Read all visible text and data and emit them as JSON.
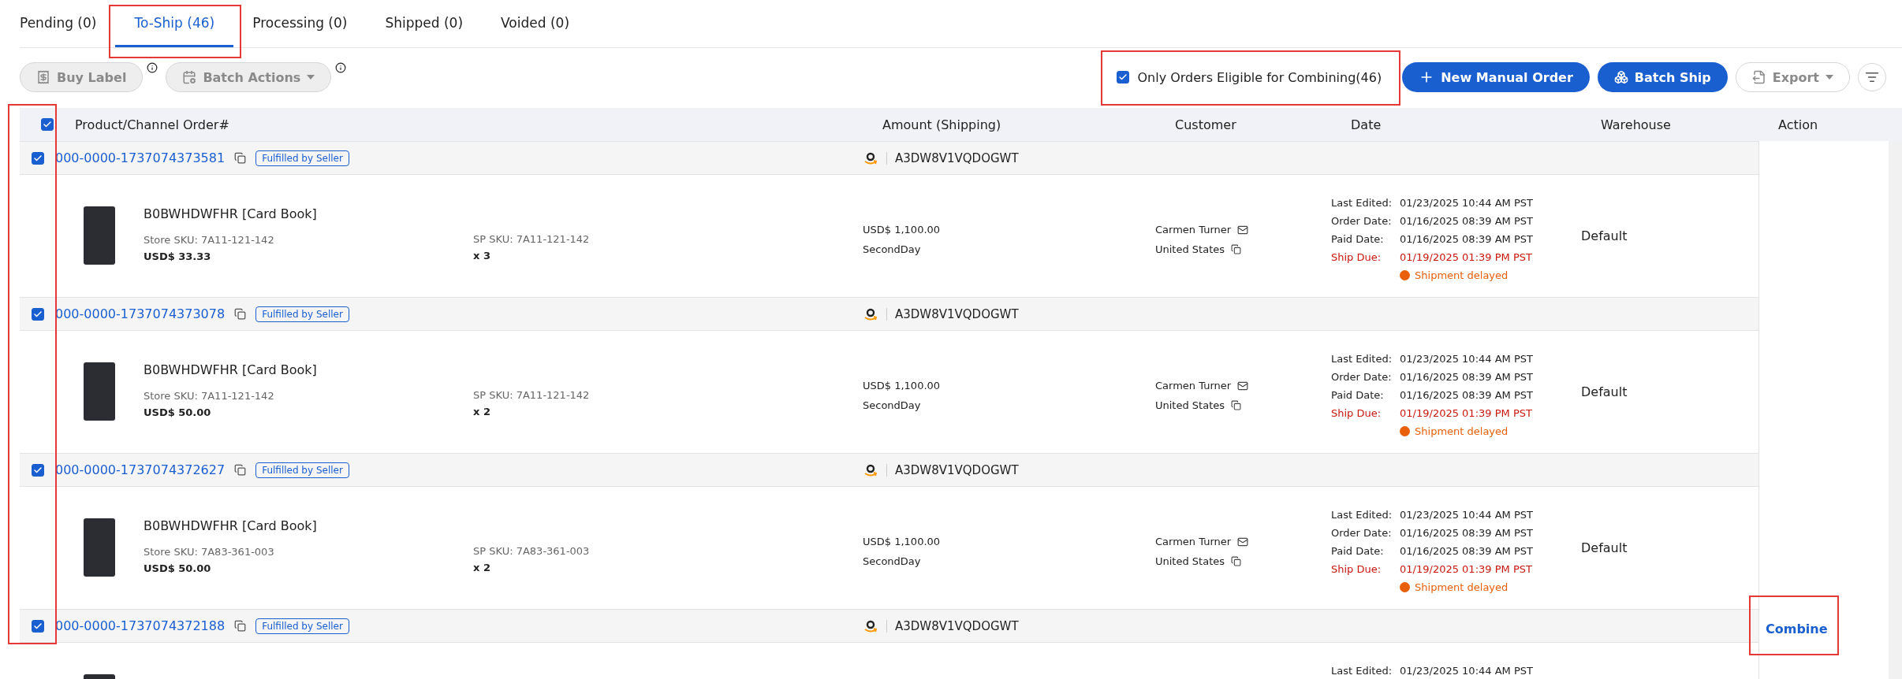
{
  "tabs": [
    {
      "label": "Pending (0)",
      "selected": false
    },
    {
      "label": "To-Ship (46)",
      "selected": true
    },
    {
      "label": "Processing (0)",
      "selected": false
    },
    {
      "label": "Shipped (0)",
      "selected": false
    },
    {
      "label": "Voided (0)",
      "selected": false
    }
  ],
  "toolbar": {
    "buy_label": {
      "label": "Buy Label",
      "disabled": true
    },
    "batch_actions": {
      "label": "Batch Actions",
      "disabled": true
    },
    "eligible_filter": {
      "label": "Only Orders Eligible for Combining(46)",
      "checked": true
    },
    "new_order": {
      "label": "New Manual Order",
      "disabled": false
    },
    "batch_ship": {
      "label": "Batch Ship",
      "disabled": false
    },
    "export": {
      "label": "Export",
      "disabled": true
    }
  },
  "table": {
    "select_all_checked": true,
    "columns": [
      "Product/Channel Order#",
      "Amount (Shipping)",
      "Customer",
      "Date",
      "Warehouse",
      "Action"
    ],
    "orders": [
      {
        "checked": true,
        "order_no": "000-0000-1737074373581",
        "fulfillment": "Fulfilled by Seller",
        "store_id": "A3DW8V1VQDOGWT",
        "product": {
          "title": "B0BWHDWFHR [Card Book]",
          "store_sku": "Store SKU: 7A11-121-142",
          "price": "USD$ 33.33",
          "sp_sku": "SP SKU: 7A11-121-142",
          "qty": "x 3"
        },
        "amount": "USD$ 1,100.00",
        "shipping": "SecondDay",
        "customer": "Carmen Turner",
        "country": "United States",
        "dates": [
          {
            "label": "Last Edited:",
            "value": "01/23/2025 10:44 AM PST",
            "kind": "normal"
          },
          {
            "label": "Order Date:",
            "value": "01/16/2025 08:39 AM PST",
            "kind": "normal"
          },
          {
            "label": "Paid Date:",
            "value": "01/16/2025 08:39 AM PST",
            "kind": "normal"
          },
          {
            "label": "Ship Due:",
            "value": "01/19/2025 01:39 PM PST",
            "kind": "due"
          }
        ],
        "alert": "Shipment delayed",
        "warehouse": "Default"
      },
      {
        "checked": true,
        "order_no": "000-0000-1737074373078",
        "fulfillment": "Fulfilled by Seller",
        "store_id": "A3DW8V1VQDOGWT",
        "product": {
          "title": "B0BWHDWFHR [Card Book]",
          "store_sku": "Store SKU: 7A11-121-142",
          "price": "USD$ 50.00",
          "sp_sku": "SP SKU: 7A11-121-142",
          "qty": "x 2"
        },
        "amount": "USD$ 1,100.00",
        "shipping": "SecondDay",
        "customer": "Carmen Turner",
        "country": "United States",
        "dates": [
          {
            "label": "Last Edited:",
            "value": "01/23/2025 10:44 AM PST",
            "kind": "normal"
          },
          {
            "label": "Order Date:",
            "value": "01/16/2025 08:39 AM PST",
            "kind": "normal"
          },
          {
            "label": "Paid Date:",
            "value": "01/16/2025 08:39 AM PST",
            "kind": "normal"
          },
          {
            "label": "Ship Due:",
            "value": "01/19/2025 01:39 PM PST",
            "kind": "due"
          }
        ],
        "alert": "Shipment delayed",
        "warehouse": "Default"
      },
      {
        "checked": true,
        "order_no": "000-0000-1737074372627",
        "fulfillment": "Fulfilled by Seller",
        "store_id": "A3DW8V1VQDOGWT",
        "product": {
          "title": "B0BWHDWFHR [Card Book]",
          "store_sku": "Store SKU: 7A83-361-003",
          "price": "USD$ 50.00",
          "sp_sku": "SP SKU: 7A83-361-003",
          "qty": "x 2"
        },
        "amount": "USD$ 1,100.00",
        "shipping": "SecondDay",
        "customer": "Carmen Turner",
        "country": "United States",
        "dates": [
          {
            "label": "Last Edited:",
            "value": "01/23/2025 10:44 AM PST",
            "kind": "normal"
          },
          {
            "label": "Order Date:",
            "value": "01/16/2025 08:39 AM PST",
            "kind": "normal"
          },
          {
            "label": "Paid Date:",
            "value": "01/16/2025 08:39 AM PST",
            "kind": "normal"
          },
          {
            "label": "Ship Due:",
            "value": "01/19/2025 01:39 PM PST",
            "kind": "due"
          }
        ],
        "alert": "Shipment delayed",
        "warehouse": "Default"
      },
      {
        "checked": true,
        "order_no": "000-0000-1737074372188",
        "fulfillment": "Fulfilled by Seller",
        "store_id": "A3DW8V1VQDOGWT",
        "dates": [
          {
            "label": "Last Edited:",
            "value": "01/23/2025 10:44 AM PST",
            "kind": "normal"
          }
        ]
      }
    ],
    "action": "Combine"
  }
}
